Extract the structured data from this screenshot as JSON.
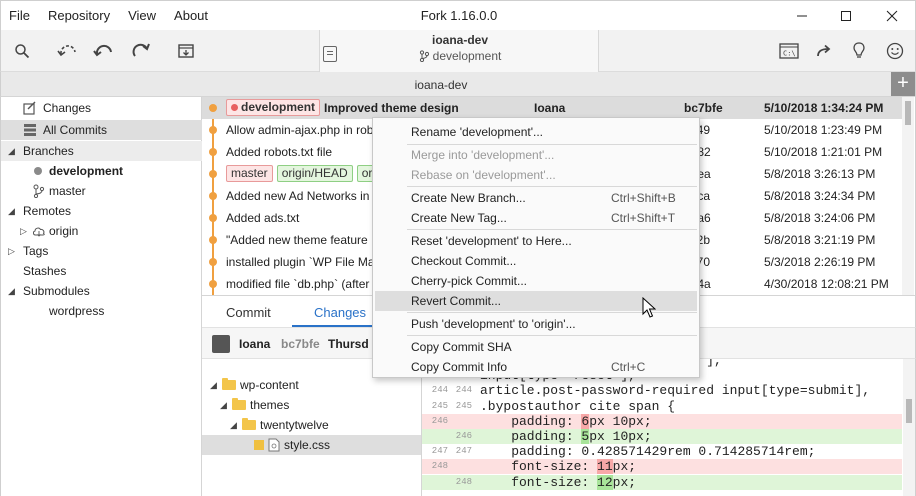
{
  "window": {
    "title": "Fork 1.16.0.0",
    "menu": [
      "File",
      "Repository",
      "View",
      "About"
    ]
  },
  "toolbar": {
    "repo_name": "ioana-dev",
    "repo_branch": "development"
  },
  "tab": {
    "label": "ioana-dev",
    "add_label": "+"
  },
  "sidebar": {
    "changes": "Changes",
    "all_commits": "All Commits",
    "branches": "Branches",
    "branch_development": "development",
    "branch_master": "master",
    "remotes": "Remotes",
    "remote_origin": "origin",
    "tags": "Tags",
    "stashes": "Stashes",
    "submodules": "Submodules",
    "submodule_wordpress": "wordpress"
  },
  "commits": [
    {
      "tags": [
        {
          "label": "development",
          "style": "red"
        }
      ],
      "message": "Improved theme design",
      "author": "Ioana",
      "sha": "bc7bfe",
      "date": "5/10/2018 1:34:24 PM"
    },
    {
      "tags": [],
      "message": "Allow admin-ajax.php in rob",
      "author": "",
      "sha": "ac49",
      "date": "5/10/2018 1:23:49 PM"
    },
    {
      "tags": [],
      "message": "Added robots.txt file",
      "author": "",
      "sha": "2e82",
      "date": "5/10/2018 1:21:01 PM"
    },
    {
      "tags": [
        {
          "label": "master",
          "style": "red"
        },
        {
          "label": "origin/HEAD",
          "style": "green"
        },
        {
          "label": "or",
          "style": "green"
        }
      ],
      "message": "",
      "author": "",
      "sha": "13ea",
      "date": "5/8/2018 3:26:13 PM"
    },
    {
      "tags": [],
      "message": "Added new Ad Networks in",
      "author": "",
      "sha": "3bca",
      "date": "5/8/2018 3:24:34 PM"
    },
    {
      "tags": [],
      "message": "Added ads.txt",
      "author": "",
      "sha": "25a6",
      "date": "5/8/2018 3:24:06 PM"
    },
    {
      "tags": [],
      "message": "\"Added new theme feature",
      "author": "",
      "sha": "ce2b",
      "date": "5/8/2018 3:21:19 PM"
    },
    {
      "tags": [],
      "message": "installed plugin `WP File Ma",
      "author": "",
      "sha": "ca70",
      "date": "5/3/2018 2:26:19 PM"
    },
    {
      "tags": [],
      "message": "modified file `db.php` (after",
      "author": "",
      "sha": "974a",
      "date": "4/30/2018 12:08:21 PM"
    }
  ],
  "bottom_tabs": {
    "commit": "Commit",
    "changes": "Changes"
  },
  "commit_info": {
    "author": "Ioana",
    "sha": "bc7bfe",
    "date": "Thursd"
  },
  "file_tree": {
    "wp_content": "wp-content",
    "themes": "themes",
    "twentytwelve": "twentytwelve",
    "style_css": "style.css"
  },
  "diff_lines": [
    {
      "n1": "",
      "n2": "",
      "code": "                    =\"button\"],",
      "kind": "ctx"
    },
    {
      "n1": "243",
      "n2": "243",
      "code": "input[type= reset ],",
      "kind": "ctx"
    },
    {
      "n1": "244",
      "n2": "244",
      "code": "article.post-password-required input[type=submit],",
      "kind": "ctx"
    },
    {
      "n1": "245",
      "n2": "245",
      "code": ".bypostauthor cite span {",
      "kind": "ctx"
    },
    {
      "n1": "246",
      "n2": "",
      "pre": "    padding: ",
      "hl": "6",
      "post": "px 10px;",
      "kind": "del"
    },
    {
      "n1": "",
      "n2": "246",
      "pre": "    padding: ",
      "hl": "5",
      "post": "px 10px;",
      "kind": "add"
    },
    {
      "n1": "247",
      "n2": "247",
      "code": "    padding: 0.428571429rem 0.714285714rem;",
      "kind": "ctx"
    },
    {
      "n1": "248",
      "n2": "",
      "pre": "    font-size: ",
      "hl": "11",
      "post": "px;",
      "kind": "del"
    },
    {
      "n1": "",
      "n2": "248",
      "pre": "    font-size: ",
      "hl": "12",
      "post": "px;",
      "kind": "add"
    }
  ],
  "context_menu": {
    "rename": "Rename 'development'...",
    "merge": "Merge into 'development'...",
    "rebase": "Rebase on 'development'...",
    "create_branch": "Create New Branch...",
    "create_branch_shortcut": "Ctrl+Shift+B",
    "create_tag": "Create New Tag...",
    "create_tag_shortcut": "Ctrl+Shift+T",
    "reset": "Reset 'development' to Here...",
    "checkout": "Checkout Commit...",
    "cherry_pick": "Cherry-pick Commit...",
    "revert": "Revert Commit...",
    "push": "Push 'development' to 'origin'...",
    "copy_sha": "Copy Commit SHA",
    "copy_info": "Copy Commit Info",
    "copy_info_shortcut": "Ctrl+C"
  },
  "colors": {
    "graph": "#f0a040",
    "accent": "#2a72c8",
    "tag_red_bg": "#fde5e5",
    "tag_green_bg": "#e4f6de"
  }
}
